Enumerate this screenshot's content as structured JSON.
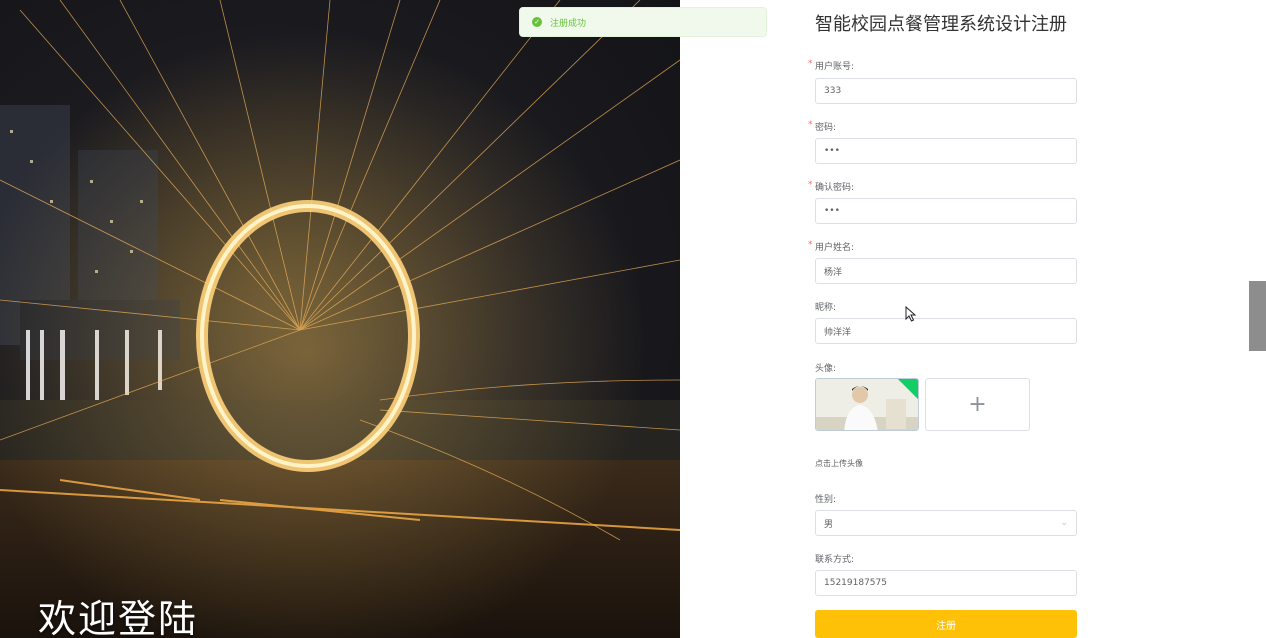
{
  "left": {
    "welcome": "欢迎登陆"
  },
  "toast": {
    "message": "注册成功",
    "icon": "check-circle-icon",
    "color": "#67c23a"
  },
  "form": {
    "title": "智能校园点餐管理系统设计注册",
    "fields": [
      {
        "label": "用户账号:",
        "required": true,
        "value": "333"
      },
      {
        "label": "密码:",
        "required": true,
        "value": "•••"
      },
      {
        "label": "确认密码:",
        "required": true,
        "value": "•••"
      },
      {
        "label": "用户姓名:",
        "required": true,
        "value": "杨洋"
      },
      {
        "label": "昵称:",
        "required": false,
        "value": "帅洋洋"
      }
    ],
    "avatar": {
      "label": "头像:",
      "hint": "点击上传头像",
      "upload_icon": "+"
    },
    "gender": {
      "label": "性别:",
      "value": "男"
    },
    "contact": {
      "label": "联系方式:",
      "value": "15219187575"
    },
    "submit_label": "注册",
    "accent": "#ffc107"
  }
}
